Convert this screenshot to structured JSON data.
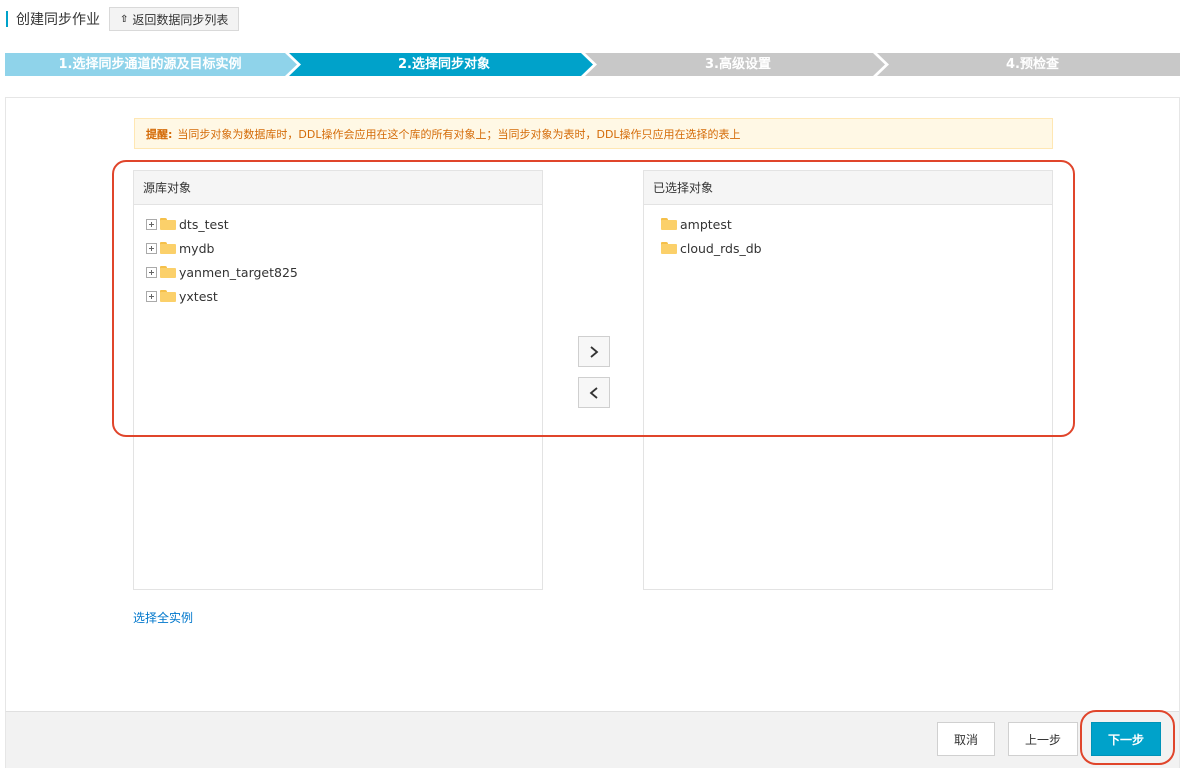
{
  "header": {
    "title": "创建同步作业",
    "back_button": "返回数据同步列表"
  },
  "steps": [
    {
      "label": "1.选择同步通道的源及目标实例",
      "state": "done",
      "color": "#8fd3ea"
    },
    {
      "label": "2.选择同步对象",
      "state": "active",
      "color": "#00a2ca"
    },
    {
      "label": "3.高级设置",
      "state": "pending",
      "color": "#c8c8c8"
    },
    {
      "label": "4.预检查",
      "state": "pending",
      "color": "#c8c8c8"
    }
  ],
  "notice": {
    "prefix": "提醒:",
    "text": "当同步对象为数据库时，DDL操作会应用在这个库的所有对象上；当同步对象为表时，DDL操作只应用在选择的表上"
  },
  "source_panel": {
    "title": "源库对象",
    "items": [
      "dts_test",
      "mydb",
      "yanmen_target825",
      "yxtest"
    ]
  },
  "selected_panel": {
    "title": "已选择对象",
    "items": [
      "amptest",
      "cloud_rds_db"
    ]
  },
  "move_buttons": {
    "add_icon": "chevron-right-icon",
    "remove_icon": "chevron-left-icon"
  },
  "select_all_link": "选择全实例",
  "footer": {
    "cancel": "取消",
    "prev": "上一步",
    "next": "下一步"
  },
  "colors": {
    "accent": "#00a2ca",
    "highlight": "#e0452b",
    "notice_text": "#d46b08"
  }
}
